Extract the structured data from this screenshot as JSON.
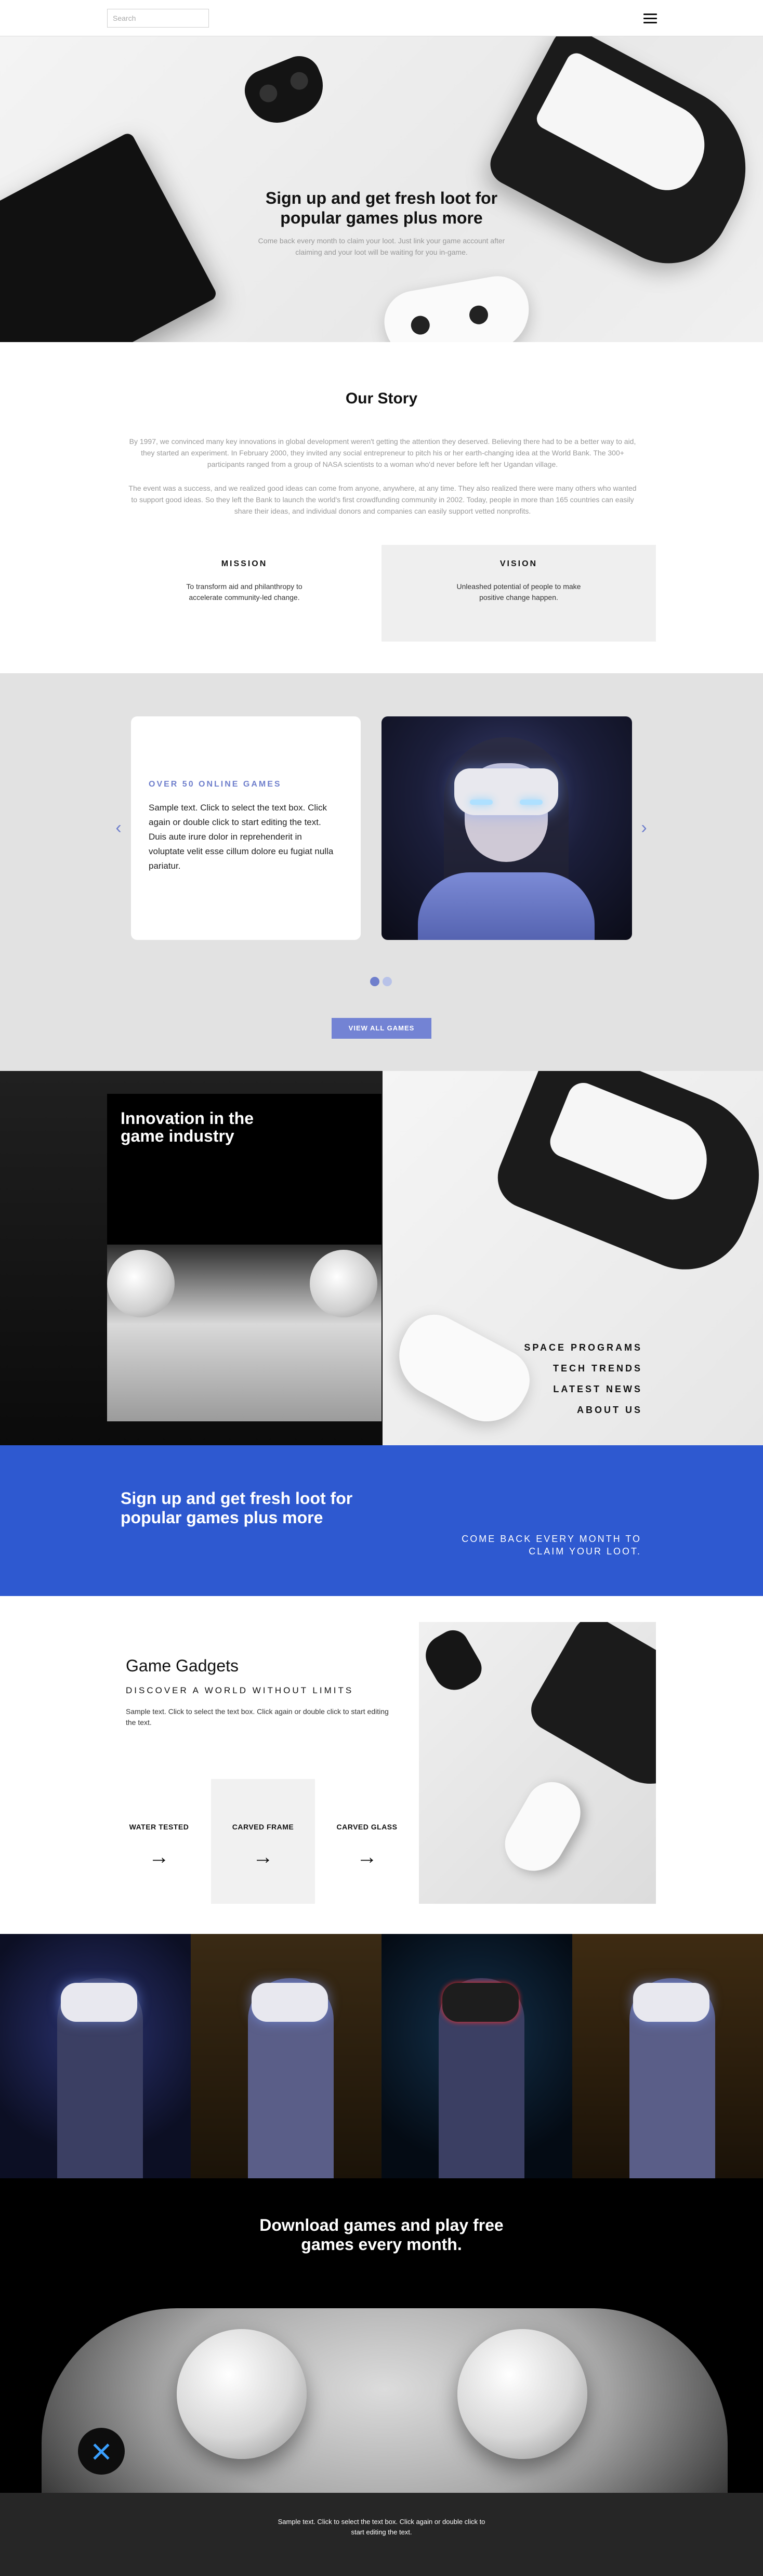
{
  "header": {
    "search_placeholder": "Search"
  },
  "hero": {
    "title": "Sign up and get fresh loot for popular games plus more",
    "subtitle": "Come back every month to claim your loot. Just link your game account after claiming and your loot will be waiting for you in-game."
  },
  "story": {
    "title": "Our Story",
    "paragraph1": "By 1997, we convinced many key innovations in global development weren't getting the attention they deserved. Believing there had to be a better way to aid, they started an experiment. In February 2000, they invited any social entrepreneur to pitch his or her earth-changing idea at the World Bank. The 300+ participants ranged from a group of NASA scientists to a woman who'd never before left her Ugandan village.",
    "paragraph2": "The event was a success, and we realized good ideas can come from anyone, anywhere, at any time. They also realized there were many others who wanted to support good ideas. So they left the Bank to launch the world's first crowdfunding community in 2002. Today, people in more than 165 countries can easily share their ideas, and individual donors and companies can easily support vetted nonprofits.",
    "mission": {
      "title": "MISSION",
      "text": "To transform aid and philanthropy to accelerate community-led change."
    },
    "vision": {
      "title": "VISION",
      "text": "Unleashed potential of people to make positive change happen."
    }
  },
  "games": {
    "kicker": "OVER 50 ONLINE GAMES",
    "body": "Sample text. Click to select the text box. Click again or double click to start editing the text. Duis aute irure dolor in reprehenderit in voluptate velit esse cillum dolore eu fugiat nulla pariatur.",
    "prev_arrow": "‹",
    "next_arrow": "›",
    "button": "VIEW ALL GAMES",
    "slide_count": 2,
    "active_slide": 1
  },
  "innovation": {
    "title": "Innovation in the game industry",
    "links": [
      "SPACE PROGRAMS",
      "TECH TRENDS",
      "LATEST NEWS",
      "ABOUT US"
    ]
  },
  "banner": {
    "title": "Sign up and get fresh loot for popular games plus more",
    "subtitle": "COME BACK EVERY MONTH TO CLAIM YOUR LOOT."
  },
  "gadgets": {
    "title": "Game Gadgets",
    "kicker": "DISCOVER A WORLD WITHOUT LIMITS",
    "text": "Sample text. Click to select the text box. Click again or double click to start editing the text.",
    "features": [
      {
        "label": "WATER TESTED",
        "arrow": "→"
      },
      {
        "label": "CARVED FRAME",
        "arrow": "→"
      },
      {
        "label": "CARVED GLASS",
        "arrow": "→"
      }
    ]
  },
  "download": {
    "title": "Download games and play free games every month."
  },
  "footer": {
    "text": "Sample text. Click to select the text box. Click again or double click to start editing the text."
  },
  "colors": {
    "accent": "#6f7fcc",
    "banner_blue": "#2e59d0",
    "button": "#7383d4",
    "footer": "#262626"
  }
}
